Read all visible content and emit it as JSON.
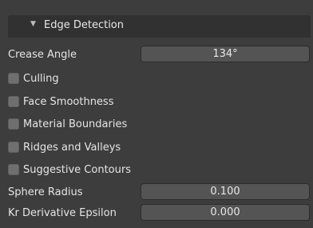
{
  "panel": {
    "title": "Edge Detection",
    "arrow_icon": "triangle-down-icon"
  },
  "properties": {
    "crease_angle": {
      "label": "Crease Angle",
      "value": "134°"
    },
    "checkboxes": [
      {
        "label": "Culling",
        "checked": false
      },
      {
        "label": "Face Smoothness",
        "checked": false
      },
      {
        "label": "Material Boundaries",
        "checked": false
      },
      {
        "label": "Ridges and Valleys",
        "checked": false
      },
      {
        "label": "Suggestive Contours",
        "checked": false
      }
    ],
    "sphere_radius": {
      "label": "Sphere Radius",
      "value": "0.100"
    },
    "kr_derivative_epsilon": {
      "label": "Kr Derivative Epsilon",
      "value": "0.000"
    }
  }
}
